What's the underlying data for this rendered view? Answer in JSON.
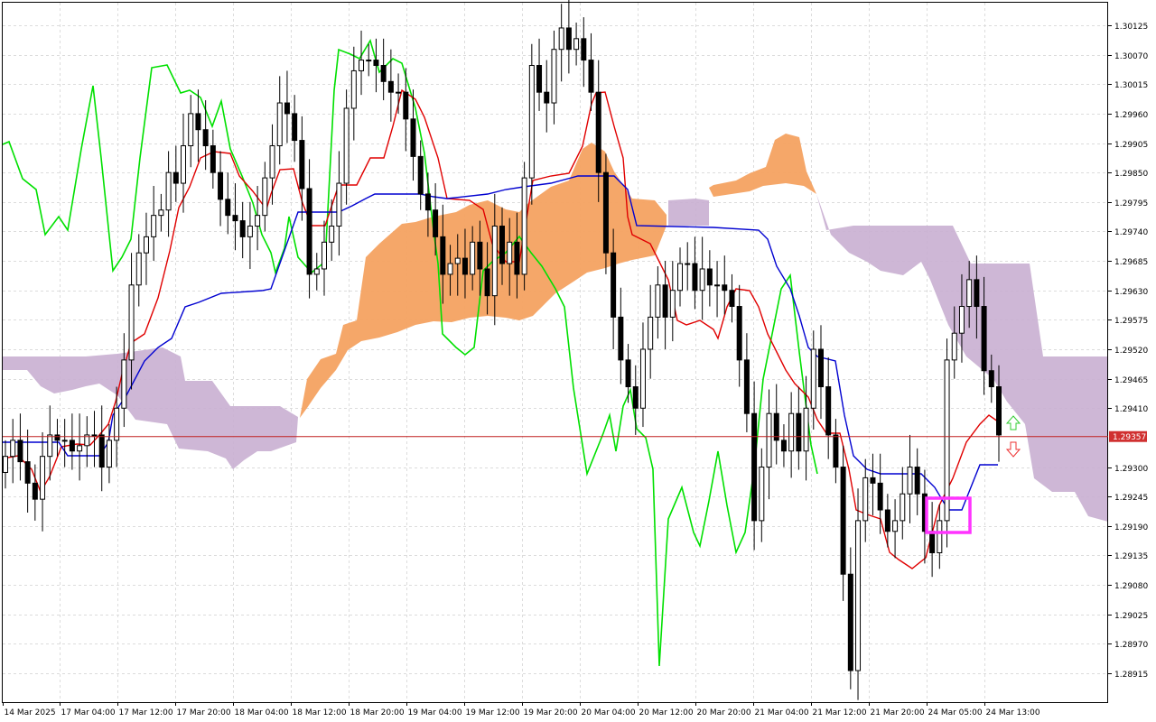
{
  "chart_data": {
    "type": "candlestick",
    "grid": true,
    "legend": "none",
    "ylim": [
      1.28875,
      1.3016
    ],
    "y_ticks": [
      "1.30125",
      "1.30070",
      "1.30015",
      "1.29960",
      "1.29905",
      "1.29850",
      "1.29795",
      "1.29740",
      "1.29685",
      "1.29630",
      "1.29575",
      "1.29520",
      "1.29465",
      "1.29410",
      "1.29300",
      "1.29245",
      "1.29190",
      "1.29135",
      "1.29080",
      "1.29025",
      "1.28970",
      "1.28915"
    ],
    "x_ticks": [
      "14 Mar 2025",
      "17 Mar 04:00",
      "17 Mar 12:00",
      "17 Mar 20:00",
      "18 Mar 04:00",
      "18 Mar 12:00",
      "18 Mar 20:00",
      "19 Mar 04:00",
      "19 Mar 12:00",
      "19 Mar 20:00",
      "20 Mar 04:00",
      "20 Mar 12:00",
      "20 Mar 20:00",
      "21 Mar 04:00",
      "21 Mar 12:00",
      "21 Mar 20:00",
      "24 Mar 05:00",
      "24 Mar 13:00"
    ],
    "current_price": "1.29357",
    "current_price_value": 1.29357,
    "candle_series": {
      "close": [
        1.2932,
        1.2935,
        1.2931,
        1.2927,
        1.2924,
        1.2932,
        1.2936,
        1.2935,
        1.2935,
        1.2933,
        1.2934,
        1.2936,
        1.2936,
        1.293,
        1.2935,
        1.2941,
        1.295,
        1.2964,
        1.297,
        1.2973,
        1.2977,
        1.2978,
        1.2985,
        1.2983,
        1.299,
        1.2996,
        1.2993,
        1.299,
        1.2985,
        1.298,
        1.2977,
        1.2976,
        1.2973,
        1.2975,
        1.2977,
        1.2984,
        1.299,
        1.2998,
        1.2996,
        1.2991,
        1.2982,
        1.2966,
        1.2967,
        1.2972,
        1.2975,
        1.2983,
        1.2997,
        1.3004,
        1.3006,
        1.3006,
        1.3005,
        1.3002,
        1.3,
        1.3,
        1.2995,
        1.2988,
        1.2981,
        1.2978,
        1.2973,
        1.2966,
        1.2968,
        1.2969,
        1.2966,
        1.2972,
        1.2967,
        1.2962,
        1.2975,
        1.2968,
        1.2972,
        1.2966,
        1.2984,
        1.3005,
        1.3,
        1.2998,
        1.3008,
        1.3012,
        1.3008,
        1.301,
        1.3006,
        1.3,
        1.2985,
        1.297,
        1.2958,
        1.295,
        1.2945,
        1.2941,
        1.2952,
        1.2958,
        1.2964,
        1.2958,
        1.2963,
        1.2968,
        1.2968,
        1.2963,
        1.2967,
        1.2964,
        1.2964,
        1.2963,
        1.296,
        1.295,
        1.294,
        1.292,
        1.293,
        1.294,
        1.2935,
        1.2933,
        1.294,
        1.2933,
        1.2941,
        1.2952,
        1.2945,
        1.2936,
        1.293,
        1.291,
        1.2892,
        1.292,
        1.2928,
        1.2927,
        1.2922,
        1.2918,
        1.292,
        1.2925,
        1.293,
        1.2925,
        1.2918,
        1.2914,
        1.292,
        1.295,
        1.2955,
        1.296,
        1.2965,
        1.296,
        1.2948,
        1.2945,
        1.2936
      ]
    }
  }
}
